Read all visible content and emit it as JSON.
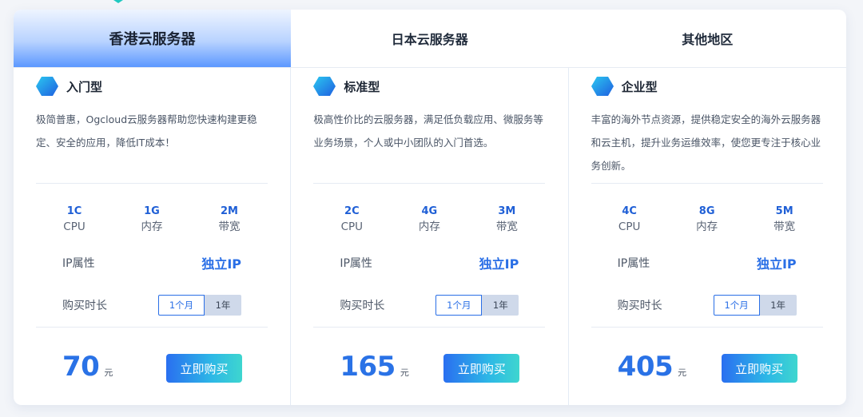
{
  "tabs": [
    {
      "label": "香港云服务器",
      "active": true
    },
    {
      "label": "日本云服务器",
      "active": false
    },
    {
      "label": "其他地区",
      "active": false
    }
  ],
  "plans": [
    {
      "title": "入门型",
      "description": "极简普惠，Ogcloud云服务器帮助您快速构建更稳定、安全的应用，降低IT成本！",
      "specs": [
        {
          "value": "1C",
          "label": "CPU"
        },
        {
          "value": "1G",
          "label": "内存"
        },
        {
          "value": "2M",
          "label": "带宽"
        }
      ],
      "ip_label": "IP属性",
      "ip_value": "独立IP",
      "duration_label": "购买时长",
      "duration_options": [
        "1个月",
        "1年"
      ],
      "price": "70",
      "price_unit": "元",
      "buy_label": "立即购买"
    },
    {
      "title": "标准型",
      "description": "极高性价比的云服务器，满足低负载应用、微服务等业务场景，个人或中小团队的入门首选。",
      "specs": [
        {
          "value": "2C",
          "label": "CPU"
        },
        {
          "value": "4G",
          "label": "内存"
        },
        {
          "value": "3M",
          "label": "带宽"
        }
      ],
      "ip_label": "IP属性",
      "ip_value": "独立IP",
      "duration_label": "购买时长",
      "duration_options": [
        "1个月",
        "1年"
      ],
      "price": "165",
      "price_unit": "元",
      "buy_label": "立即购买"
    },
    {
      "title": "企业型",
      "description": "丰富的海外节点资源，提供稳定安全的海外云服务器和云主机，提升业务运维效率，使您更专注于核心业务创新。",
      "specs": [
        {
          "value": "4C",
          "label": "CPU"
        },
        {
          "value": "8G",
          "label": "内存"
        },
        {
          "value": "5M",
          "label": "带宽"
        }
      ],
      "ip_label": "IP属性",
      "ip_value": "独立IP",
      "duration_label": "购买时长",
      "duration_options": [
        "1个月",
        "1年"
      ],
      "price": "405",
      "price_unit": "元",
      "buy_label": "立即购买"
    }
  ],
  "colors": {
    "accent": "#2a6fe6",
    "active_tab": "#5c98ff",
    "teal": "#3ed6cf"
  },
  "icons": {
    "plan_icon": "hexagon-icon"
  }
}
